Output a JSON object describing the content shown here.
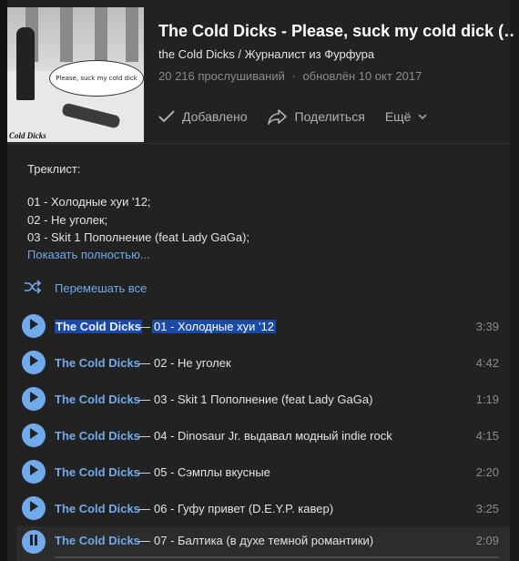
{
  "album": {
    "title": "The Cold Dicks - Please, suck my cold dick (…",
    "subtitle": "the Cold Dicks / Журналист из Фурфура",
    "plays": "20 216 прослушиваний",
    "updated": "обновлён 10 окт 2017",
    "cover_bubble_text": "Please, suck my cold dick",
    "cover_caption": "Cold Dicks"
  },
  "actions": {
    "added": "Добавлено",
    "share": "Поделиться",
    "more": "Ещё"
  },
  "description": {
    "label": "Треклист:",
    "lines": [
      "01 - Холодные хуи '12;",
      "02 - Не уголек;",
      "03 - Skit 1 Пополнение (feat Lady GaGa);"
    ],
    "show_more": "Показать полностью..."
  },
  "shuffle_label": "Перемешать все",
  "tracks": [
    {
      "artist": "The Cold Dicks",
      "dash": "—",
      "name": "01 - Холодные хуи '12",
      "duration": "3:39"
    },
    {
      "artist": "The Cold Dicks",
      "dash": "—",
      "name": "02 - Не уголек",
      "duration": "4:42"
    },
    {
      "artist": "The Cold Dicks",
      "dash": "—",
      "name": "03 - Skit 1 Пополнение (feat Lady GaGa)",
      "duration": "1:19"
    },
    {
      "artist": "The Cold Dicks",
      "dash": "—",
      "name": "04 - Dinosaur Jr. выдавал модный indie rock",
      "duration": "4:15"
    },
    {
      "artist": "The Cold Dicks",
      "dash": "—",
      "name": "05 - Сэмплы вкусные",
      "duration": "2:20"
    },
    {
      "artist": "The Cold Dicks",
      "dash": "—",
      "name": "06 - Гуфу привет (D.E.Y.P. кавер)",
      "duration": "3:25"
    },
    {
      "artist": "The Cold Dicks",
      "dash": "—",
      "name": "07 - Балтика (в духе темной романтики)",
      "duration": "2:09"
    }
  ],
  "playback": {
    "current_track_index": 6,
    "progress_fraction": 0.0
  },
  "colors": {
    "accent": "#71aaeb",
    "background": "#222222",
    "selection": "#1a4aa8"
  }
}
